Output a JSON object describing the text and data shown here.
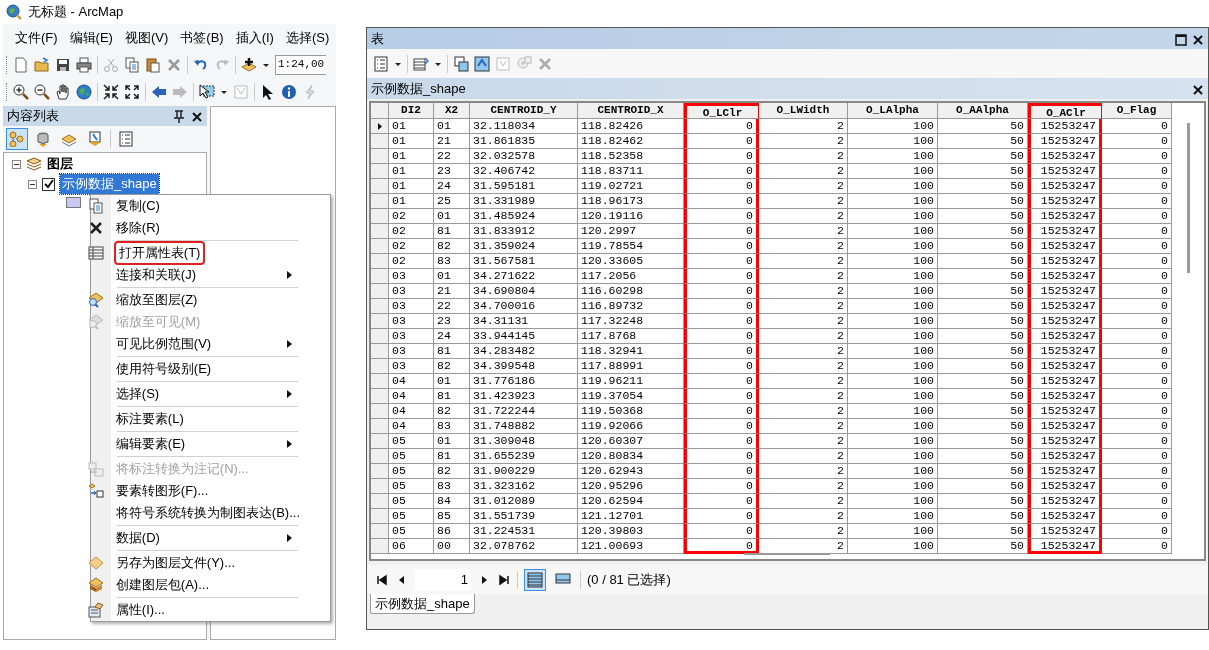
{
  "arcmap": {
    "title": "无标题 - ArcMap",
    "menu": [
      "文件(F)",
      "编辑(E)",
      "视图(V)",
      "书签(B)",
      "插入(I)",
      "选择(S)"
    ],
    "scale": "1:24,00",
    "toc": {
      "title": "内容列表",
      "views": [
        {
          "selected": true
        },
        {
          "selected": false
        },
        {
          "selected": false
        },
        {
          "selected": false
        },
        {
          "selected": false
        }
      ],
      "tree": [
        {
          "label": "图层",
          "expanded": true,
          "children": [
            {
              "label": "示例数据_shape",
              "expanded": true,
              "checked": true,
              "selected": true
            }
          ]
        }
      ]
    },
    "context_menu": [
      [
        {
          "label": "复制(C)",
          "disabled": false,
          "submenu": false,
          "highlighted": false
        },
        {
          "label": "移除(R)",
          "disabled": false,
          "submenu": false,
          "highlighted": false
        }
      ],
      [
        {
          "label": "打开属性表(T)",
          "disabled": false,
          "submenu": false,
          "highlighted": true
        },
        {
          "label": "连接和关联(J)",
          "disabled": false,
          "submenu": true,
          "highlighted": false
        }
      ],
      [
        {
          "label": "缩放至图层(Z)",
          "disabled": false,
          "submenu": false,
          "highlighted": false
        },
        {
          "label": "缩放至可见(M)",
          "disabled": true,
          "submenu": false,
          "highlighted": false
        },
        {
          "label": "可见比例范围(V)",
          "disabled": false,
          "submenu": true,
          "highlighted": false
        }
      ],
      [
        {
          "label": "使用符号级别(E)",
          "disabled": false,
          "submenu": false,
          "highlighted": false
        }
      ],
      [
        {
          "label": "选择(S)",
          "disabled": false,
          "submenu": true,
          "highlighted": false
        }
      ],
      [
        {
          "label": "标注要素(L)",
          "disabled": false,
          "submenu": false,
          "highlighted": false
        }
      ],
      [
        {
          "label": "编辑要素(E)",
          "disabled": false,
          "submenu": true,
          "highlighted": false
        }
      ],
      [
        {
          "label": "将标注转换为注记(N)...",
          "disabled": true,
          "submenu": false,
          "highlighted": false
        },
        {
          "label": "要素转图形(F)...",
          "disabled": false,
          "submenu": false,
          "highlighted": false
        },
        {
          "label": "将符号系统转换为制图表达(B)...",
          "disabled": false,
          "submenu": false,
          "highlighted": false
        }
      ],
      [
        {
          "label": "数据(D)",
          "disabled": false,
          "submenu": true,
          "highlighted": false
        }
      ],
      [
        {
          "label": "另存为图层文件(Y)...",
          "disabled": false,
          "submenu": false,
          "highlighted": false
        },
        {
          "label": "创建图层包(A)...",
          "disabled": false,
          "submenu": false,
          "highlighted": false
        }
      ],
      [
        {
          "label": "属性(I)...",
          "disabled": false,
          "submenu": false,
          "highlighted": false
        }
      ]
    ]
  },
  "table_window": {
    "title": "表",
    "table_name": "示例数据_shape",
    "columns": [
      {
        "label": "DI2",
        "kind": "text",
        "highlighted": false
      },
      {
        "label": "X2",
        "kind": "text",
        "highlighted": false
      },
      {
        "label": "CENTROID_Y",
        "kind": "text",
        "highlighted": false
      },
      {
        "label": "CENTROID_X",
        "kind": "text",
        "highlighted": false
      },
      {
        "label": "O_LClr",
        "kind": "number",
        "highlighted": true
      },
      {
        "label": "O_LWidth",
        "kind": "number",
        "highlighted": false
      },
      {
        "label": "O_LAlpha",
        "kind": "number",
        "highlighted": false
      },
      {
        "label": "O_AAlpha",
        "kind": "number",
        "highlighted": false
      },
      {
        "label": "O_AClr",
        "kind": "number",
        "highlighted": true
      },
      {
        "label": "O_Flag",
        "kind": "number",
        "highlighted": false
      }
    ],
    "rows": [
      {
        "current": true,
        "cells": [
          "01",
          "01",
          "32.118034",
          "118.82426",
          "0",
          "2",
          "100",
          "50",
          "15253247",
          "0"
        ]
      },
      {
        "current": false,
        "cells": [
          "01",
          "21",
          "31.861835",
          "118.82462",
          "0",
          "2",
          "100",
          "50",
          "15253247",
          "0"
        ]
      },
      {
        "current": false,
        "cells": [
          "01",
          "22",
          "32.032578",
          "118.52358",
          "0",
          "2",
          "100",
          "50",
          "15253247",
          "0"
        ]
      },
      {
        "current": false,
        "cells": [
          "01",
          "23",
          "32.406742",
          "118.83711",
          "0",
          "2",
          "100",
          "50",
          "15253247",
          "0"
        ]
      },
      {
        "current": false,
        "cells": [
          "01",
          "24",
          "31.595181",
          "119.02721",
          "0",
          "2",
          "100",
          "50",
          "15253247",
          "0"
        ]
      },
      {
        "current": false,
        "cells": [
          "01",
          "25",
          "31.331989",
          "118.96173",
          "0",
          "2",
          "100",
          "50",
          "15253247",
          "0"
        ]
      },
      {
        "current": false,
        "cells": [
          "02",
          "01",
          "31.485924",
          "120.19116",
          "0",
          "2",
          "100",
          "50",
          "15253247",
          "0"
        ]
      },
      {
        "current": false,
        "cells": [
          "02",
          "81",
          "31.833912",
          "120.2997",
          "0",
          "2",
          "100",
          "50",
          "15253247",
          "0"
        ]
      },
      {
        "current": false,
        "cells": [
          "02",
          "82",
          "31.359024",
          "119.78554",
          "0",
          "2",
          "100",
          "50",
          "15253247",
          "0"
        ]
      },
      {
        "current": false,
        "cells": [
          "02",
          "83",
          "31.567581",
          "120.33605",
          "0",
          "2",
          "100",
          "50",
          "15253247",
          "0"
        ]
      },
      {
        "current": false,
        "cells": [
          "03",
          "01",
          "34.271622",
          "117.2056",
          "0",
          "2",
          "100",
          "50",
          "15253247",
          "0"
        ]
      },
      {
        "current": false,
        "cells": [
          "03",
          "21",
          "34.690804",
          "116.60298",
          "0",
          "2",
          "100",
          "50",
          "15253247",
          "0"
        ]
      },
      {
        "current": false,
        "cells": [
          "03",
          "22",
          "34.700016",
          "116.89732",
          "0",
          "2",
          "100",
          "50",
          "15253247",
          "0"
        ]
      },
      {
        "current": false,
        "cells": [
          "03",
          "23",
          "34.31131",
          "117.32248",
          "0",
          "2",
          "100",
          "50",
          "15253247",
          "0"
        ]
      },
      {
        "current": false,
        "cells": [
          "03",
          "24",
          "33.944145",
          "117.8768",
          "0",
          "2",
          "100",
          "50",
          "15253247",
          "0"
        ]
      },
      {
        "current": false,
        "cells": [
          "03",
          "81",
          "34.283482",
          "118.32941",
          "0",
          "2",
          "100",
          "50",
          "15253247",
          "0"
        ]
      },
      {
        "current": false,
        "cells": [
          "03",
          "82",
          "34.399548",
          "117.88991",
          "0",
          "2",
          "100",
          "50",
          "15253247",
          "0"
        ]
      },
      {
        "current": false,
        "cells": [
          "04",
          "01",
          "31.776186",
          "119.96211",
          "0",
          "2",
          "100",
          "50",
          "15253247",
          "0"
        ]
      },
      {
        "current": false,
        "cells": [
          "04",
          "81",
          "31.423923",
          "119.37054",
          "0",
          "2",
          "100",
          "50",
          "15253247",
          "0"
        ]
      },
      {
        "current": false,
        "cells": [
          "04",
          "82",
          "31.722244",
          "119.50368",
          "0",
          "2",
          "100",
          "50",
          "15253247",
          "0"
        ]
      },
      {
        "current": false,
        "cells": [
          "04",
          "83",
          "31.748882",
          "119.92066",
          "0",
          "2",
          "100",
          "50",
          "15253247",
          "0"
        ]
      },
      {
        "current": false,
        "cells": [
          "05",
          "01",
          "31.309048",
          "120.60307",
          "0",
          "2",
          "100",
          "50",
          "15253247",
          "0"
        ]
      },
      {
        "current": false,
        "cells": [
          "05",
          "81",
          "31.655239",
          "120.80834",
          "0",
          "2",
          "100",
          "50",
          "15253247",
          "0"
        ]
      },
      {
        "current": false,
        "cells": [
          "05",
          "82",
          "31.900229",
          "120.62943",
          "0",
          "2",
          "100",
          "50",
          "15253247",
          "0"
        ]
      },
      {
        "current": false,
        "cells": [
          "05",
          "83",
          "31.323162",
          "120.95296",
          "0",
          "2",
          "100",
          "50",
          "15253247",
          "0"
        ]
      },
      {
        "current": false,
        "cells": [
          "05",
          "84",
          "31.012089",
          "120.62594",
          "0",
          "2",
          "100",
          "50",
          "15253247",
          "0"
        ]
      },
      {
        "current": false,
        "cells": [
          "05",
          "85",
          "31.551739",
          "121.12701",
          "0",
          "2",
          "100",
          "50",
          "15253247",
          "0"
        ]
      },
      {
        "current": false,
        "cells": [
          "05",
          "86",
          "31.224531",
          "120.39803",
          "0",
          "2",
          "100",
          "50",
          "15253247",
          "0"
        ]
      },
      {
        "current": false,
        "cells": [
          "06",
          "00",
          "32.078762",
          "121.00693",
          "0",
          "2",
          "100",
          "50",
          "15253247",
          "0"
        ]
      }
    ],
    "record": "1",
    "views": [
      {
        "selected": true
      },
      {
        "selected": false
      }
    ],
    "selection_status": "(0 / 81 已选择)",
    "tabs": [
      {
        "label": "示例数据_shape",
        "selected": true
      }
    ]
  }
}
